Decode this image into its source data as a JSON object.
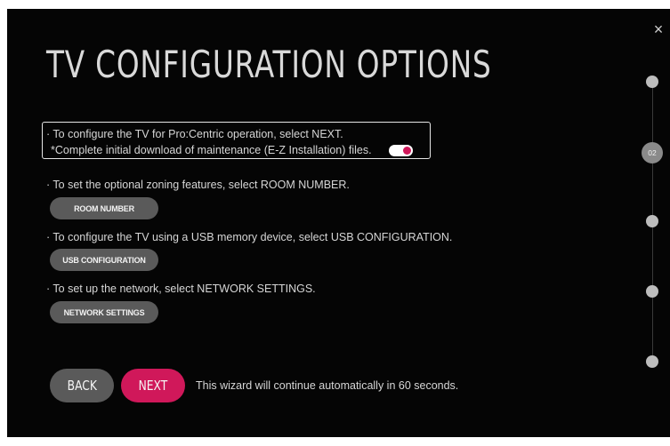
{
  "title": "TV CONFIGURATION OPTIONS",
  "close_icon": "×",
  "highlight": {
    "line1": "· To configure the TV for Pro:Centric operation, select NEXT.",
    "line2": "*Complete initial download of maintenance (E-Z Installation) files.",
    "toggle_on": true
  },
  "options": [
    {
      "instruction": "· To set the optional zoning features, select ROOM NUMBER.",
      "button_label": "ROOM NUMBER"
    },
    {
      "instruction": "· To configure the TV using a USB memory device, select USB CONFIGURATION.",
      "button_label": "USB CONFIGURATION"
    },
    {
      "instruction": "· To set up the network, select NETWORK SETTINGS.",
      "button_label": "NETWORK SETTINGS"
    }
  ],
  "footer": {
    "back_label": "BACK",
    "next_label": "NEXT",
    "auto_message": "This wizard will continue automatically in 60 seconds."
  },
  "steps": {
    "active_label": "02",
    "count": 5,
    "active_index": 1
  },
  "colors": {
    "accent": "#d0185a",
    "button_gray": "#5a5a5a",
    "background": "#050505"
  }
}
